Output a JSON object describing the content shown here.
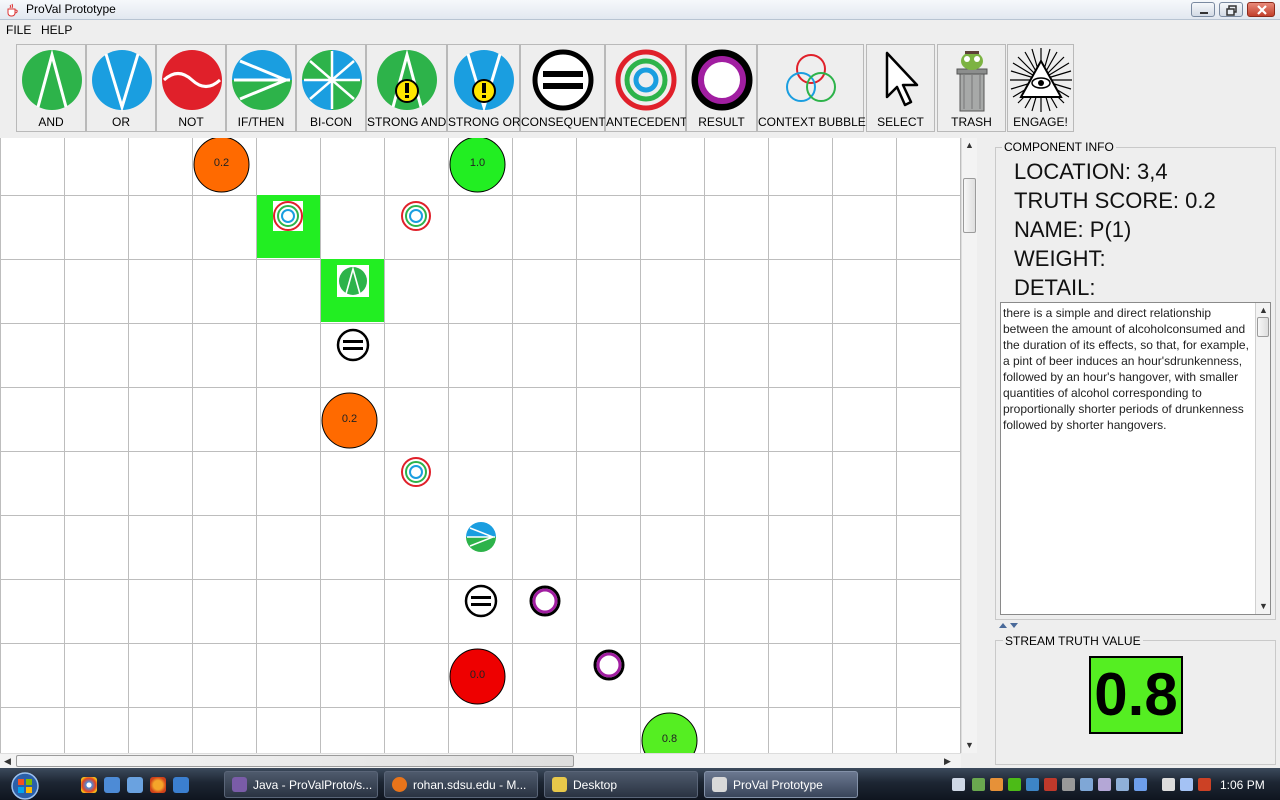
{
  "window": {
    "title": "ProVal Prototype"
  },
  "menu": {
    "file": "FILE",
    "help": "HELP"
  },
  "toolbar": {
    "tools": [
      {
        "label": "AND",
        "icon": "and-icon"
      },
      {
        "label": "OR",
        "icon": "or-icon"
      },
      {
        "label": "NOT",
        "icon": "not-icon"
      },
      {
        "label": "IF/THEN",
        "icon": "if-then-icon"
      },
      {
        "label": "BI-CON",
        "icon": "bi-con-icon"
      },
      {
        "label": "STRONG AND",
        "icon": "strong-and-icon"
      },
      {
        "label": "STRONG OR",
        "icon": "strong-or-icon"
      },
      {
        "label": "CONSEQUENT",
        "icon": "consequent-icon"
      },
      {
        "label": "ANTECEDENT",
        "icon": "antecedent-icon"
      },
      {
        "label": "RESULT",
        "icon": "result-icon"
      },
      {
        "label": "CONTEXT BUBBLE",
        "icon": "context-bubble-icon"
      },
      {
        "label": "SELECT",
        "icon": "cursor-arrow-icon"
      },
      {
        "label": "TRASH",
        "icon": "trash-can-icon"
      },
      {
        "label": "ENGAGE!",
        "icon": "eye-pyramid-icon"
      }
    ]
  },
  "canvas": {
    "nodes": [
      {
        "label": "0.2",
        "kind": "proposition",
        "color": "#ff6a00"
      },
      {
        "label": "1.0",
        "kind": "proposition",
        "color": "#22ee22"
      },
      {
        "label": "0.2",
        "kind": "proposition",
        "color": "#ff6a00"
      },
      {
        "label": "0.0",
        "kind": "proposition",
        "color": "#ee0000"
      },
      {
        "label": "0.8",
        "kind": "proposition",
        "color": "#55ee22"
      }
    ]
  },
  "component_info": {
    "title": "COMPONENT INFO",
    "location": "LOCATION: 3,4",
    "truth_score": "TRUTH SCORE: 0.2",
    "name": "NAME: P(1)",
    "weight": "WEIGHT:",
    "detail": "DETAIL:",
    "detail_text": "there is a simple and direct relationship\nbetween the amount of alcoholconsumed and\nthe duration of its effects, so that, for example,\na pint of beer induces an hour'sdrunkenness,\nfollowed by an hour's hangover, with smaller\nquantities of alcohol corresponding to\nproportionally shorter periods of drunkenness\nfollowed by shorter hangovers."
  },
  "stream": {
    "title": "STREAM TRUTH VALUE",
    "value": "0.8"
  },
  "taskbar": {
    "tasks": [
      {
        "label": "Java - ProValProto/s...",
        "icon_color": "#7a5ca8"
      },
      {
        "label": "rohan.sdsu.edu - M...",
        "icon_color": "#e8741a"
      },
      {
        "label": "Desktop",
        "icon_color": "#e8c84a"
      },
      {
        "label": "ProVal Prototype",
        "icon_color": "#d9d9d9"
      }
    ],
    "clock": "1:06 PM"
  }
}
